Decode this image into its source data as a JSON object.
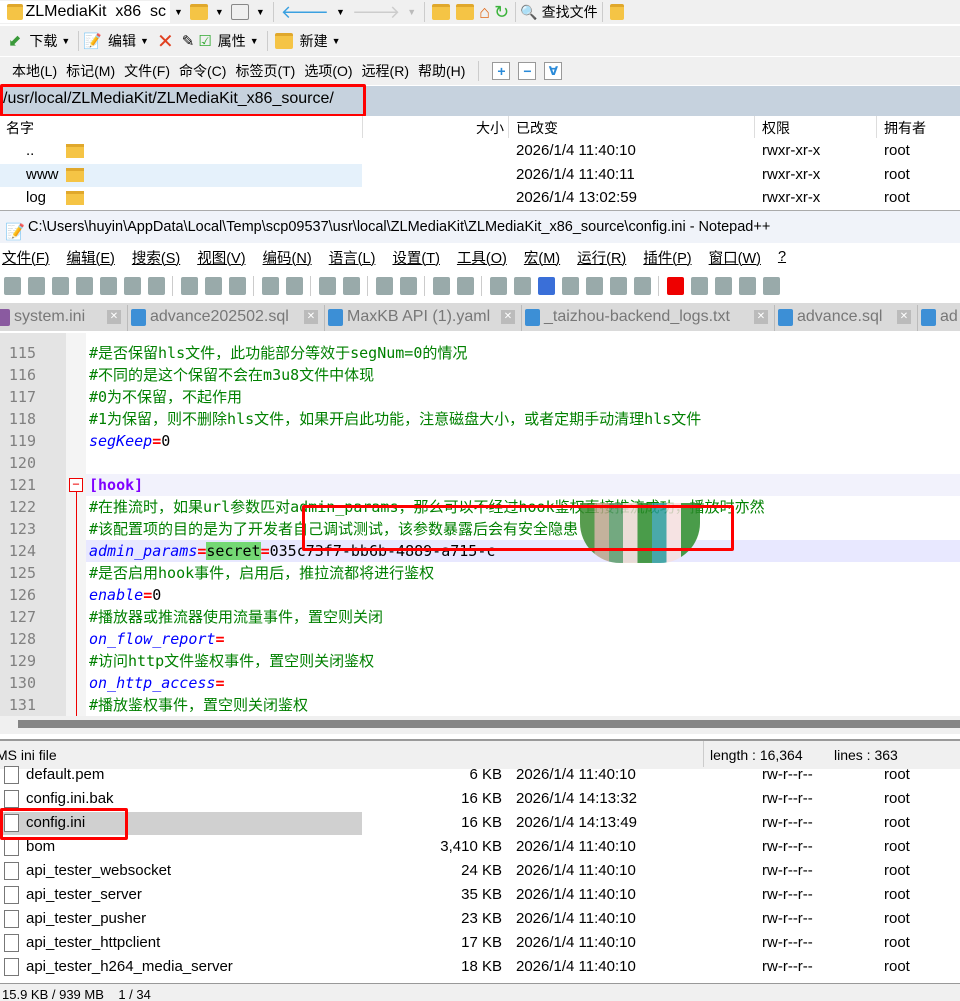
{
  "winscp": {
    "session_tab": "ZLMediaKit  x86  sc",
    "find_files": "查找文件",
    "toolbar2": {
      "download": "下载",
      "edit": "编辑",
      "properties": "属性",
      "new": "新建"
    },
    "menu": [
      "本地(L)",
      "标记(M)",
      "文件(F)",
      "命令(C)",
      "标签页(T)",
      "选项(O)",
      "远程(R)",
      "帮助(H)"
    ],
    "path": "/usr/local/ZLMediaKit/ZLMediaKit_x86_source/",
    "columns": {
      "name": "名字",
      "size": "大小",
      "changed": "已改变",
      "rights": "权限",
      "owner": "拥有者"
    },
    "top_rows": [
      {
        "name": "..",
        "size": "",
        "changed": "2026/1/4 11:40:10",
        "rights": "rwxr-xr-x",
        "owner": "root",
        "type": "parent"
      },
      {
        "name": "www",
        "size": "",
        "changed": "2026/1/4 11:40:11",
        "rights": "rwxr-xr-x",
        "owner": "root",
        "type": "folder"
      },
      {
        "name": "log",
        "size": "",
        "changed": "2026/1/4 13:02:59",
        "rights": "rwxr-xr-x",
        "owner": "root",
        "type": "folder"
      }
    ],
    "bottom_rows": [
      {
        "name": "default.pem",
        "size": "6 KB",
        "changed": "2026/1/4 11:40:10",
        "rights": "rw-r--r--",
        "owner": "root"
      },
      {
        "name": "config.ini.bak",
        "size": "16 KB",
        "changed": "2026/1/4 14:13:32",
        "rights": "rw-r--r--",
        "owner": "root"
      },
      {
        "name": "config.ini",
        "size": "16 KB",
        "changed": "2026/1/4 14:13:49",
        "rights": "rw-r--r--",
        "owner": "root"
      },
      {
        "name": "bom",
        "size": "3,410 KB",
        "changed": "2026/1/4 11:40:10",
        "rights": "rw-r--r--",
        "owner": "root"
      },
      {
        "name": "api_tester_websocket",
        "size": "24 KB",
        "changed": "2026/1/4 11:40:10",
        "rights": "rw-r--r--",
        "owner": "root"
      },
      {
        "name": "api_tester_server",
        "size": "35 KB",
        "changed": "2026/1/4 11:40:10",
        "rights": "rw-r--r--",
        "owner": "root"
      },
      {
        "name": "api_tester_pusher",
        "size": "23 KB",
        "changed": "2026/1/4 11:40:10",
        "rights": "rw-r--r--",
        "owner": "root"
      },
      {
        "name": "api_tester_httpclient",
        "size": "17 KB",
        "changed": "2026/1/4 11:40:10",
        "rights": "rw-r--r--",
        "owner": "root"
      },
      {
        "name": "api_tester_h264_media_server",
        "size": "18 KB",
        "changed": "2026/1/4 11:40:10",
        "rights": "rw-r--r--",
        "owner": "root"
      }
    ],
    "status": "15.9 KB / 939 MB    1 / 34"
  },
  "notepad": {
    "title": "C:\\Users\\huyin\\AppData\\Local\\Temp\\scp09537\\usr\\local\\ZLMediaKit\\ZLMediaKit_x86_source\\config.ini - Notepad++",
    "menu": [
      "文件(F)",
      "编辑(E)",
      "搜索(S)",
      "视图(V)",
      "编码(N)",
      "语言(L)",
      "设置(T)",
      "工具(O)",
      "宏(M)",
      "运行(R)",
      "插件(P)",
      "窗口(W)",
      "?"
    ],
    "tabs": [
      "system.ini",
      "advance202502.sql",
      "MaxKB API (1).yaml",
      "_taizhou-backend_logs.txt",
      "advance.sql",
      "ad"
    ],
    "lines": [
      {
        "n": "115",
        "tokens": [
          [
            "com",
            "#是否保留hls文件，此功能部分等效于segNum=0的情况"
          ]
        ]
      },
      {
        "n": "116",
        "tokens": [
          [
            "com",
            "#不同的是这个保留不会在m3u8文件中体现"
          ]
        ]
      },
      {
        "n": "117",
        "tokens": [
          [
            "com",
            "#0为不保留，不起作用"
          ]
        ]
      },
      {
        "n": "118",
        "tokens": [
          [
            "com",
            "#1为保留，则不删除hls文件，如果开启此功能，注意磁盘大小，或者定期手动清理hls文件"
          ]
        ]
      },
      {
        "n": "119",
        "tokens": [
          [
            "key",
            "segKeep"
          ],
          [
            "eq",
            "="
          ],
          [
            "val",
            "0"
          ]
        ]
      },
      {
        "n": "120",
        "tokens": []
      },
      {
        "n": "121",
        "tokens": [
          [
            "sec",
            "[hook]"
          ]
        ]
      },
      {
        "n": "122",
        "tokens": [
          [
            "com",
            "#在推流时，如果url参数匹对admin_params，那么可以不经过hook鉴权直接推流成功，播放时亦然"
          ]
        ]
      },
      {
        "n": "123",
        "tokens": [
          [
            "com",
            "#该配置项的目的是为了开发者自己调试测试，该参数暴露后会有安全隐患"
          ]
        ]
      },
      {
        "n": "124",
        "tokens": [
          [
            "key",
            "admin_params"
          ],
          [
            "eq",
            "="
          ],
          [
            "hl",
            "secret"
          ],
          [
            "eq",
            "="
          ],
          [
            "val",
            "035c73f7-bb6b-4889-a715-c"
          ]
        ]
      },
      {
        "n": "125",
        "tokens": [
          [
            "com",
            "#是否启用hook事件，启用后，推拉流都将进行鉴权"
          ]
        ]
      },
      {
        "n": "126",
        "tokens": [
          [
            "key",
            "enable"
          ],
          [
            "eq",
            "="
          ],
          [
            "val",
            "0"
          ]
        ]
      },
      {
        "n": "127",
        "tokens": [
          [
            "com",
            "#播放器或推流器使用流量事件，置空则关闭"
          ]
        ]
      },
      {
        "n": "128",
        "tokens": [
          [
            "key",
            "on_flow_report"
          ],
          [
            "eq",
            "="
          ]
        ]
      },
      {
        "n": "129",
        "tokens": [
          [
            "com",
            "#访问http文件鉴权事件，置空则关闭鉴权"
          ]
        ]
      },
      {
        "n": "130",
        "tokens": [
          [
            "key",
            "on_http_access"
          ],
          [
            "eq",
            "="
          ]
        ]
      },
      {
        "n": "131",
        "tokens": [
          [
            "com",
            "#播放鉴权事件，置空则关闭鉴权"
          ]
        ]
      }
    ],
    "status_type": "MS ini file",
    "status_length": "length : 16,364",
    "status_lines": "lines : 363"
  }
}
